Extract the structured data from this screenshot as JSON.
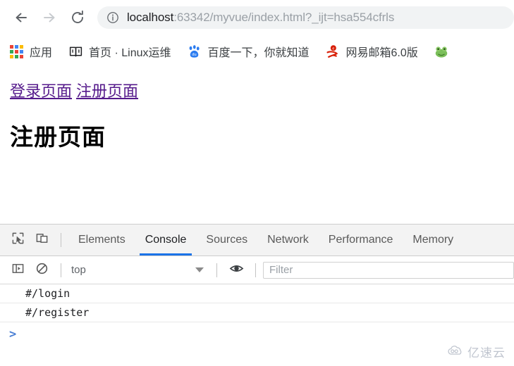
{
  "browser": {
    "nav": {
      "back_label": "Back",
      "forward_label": "Forward",
      "reload_label": "Reload"
    },
    "omnibox": {
      "info_icon": "info-circle-icon",
      "host": "localhost",
      "path": ":63342/myvue/index.html?_ijt=hsa554cfrls",
      "full_url": "localhost:63342/myvue/index.html?_ijt=hsa554cfrls"
    },
    "bookmarks": [
      {
        "label": "应用",
        "icon": "apps-grid-icon"
      },
      {
        "label": "首页 · Linux运维",
        "icon": "open-book-icon"
      },
      {
        "label": "百度一下，你就知道",
        "icon": "baidu-paw-icon"
      },
      {
        "label": "网易邮箱6.0版",
        "icon": "netease-mail-icon"
      },
      {
        "label": "",
        "icon": "frog-icon"
      }
    ]
  },
  "page": {
    "links": [
      {
        "label": "登录页面",
        "href": "#/login"
      },
      {
        "label": "注册页面",
        "href": "#/register"
      }
    ],
    "title": "注册页面"
  },
  "devtools": {
    "tools": [
      {
        "name": "inspect-element-icon"
      },
      {
        "name": "device-toolbar-icon"
      }
    ],
    "tabs": [
      {
        "label": "Elements",
        "active": false
      },
      {
        "label": "Console",
        "active": true
      },
      {
        "label": "Sources",
        "active": false
      },
      {
        "label": "Network",
        "active": false
      },
      {
        "label": "Performance",
        "active": false
      },
      {
        "label": "Memory",
        "active": false
      }
    ],
    "console_toolbar": {
      "sidebar_icon": "console-sidebar-icon",
      "clear_icon": "clear-console-icon",
      "context_value": "top",
      "eye_icon": "live-expression-eye-icon",
      "filter_placeholder": "Filter",
      "filter_value": ""
    },
    "console_messages": [
      "#/login",
      "#/register"
    ],
    "prompt_symbol": ">"
  },
  "watermark": {
    "text": "亿速云",
    "icon": "cloud-icon"
  },
  "colors": {
    "accent_blue": "#1a73e8",
    "visited_link": "#551a8b",
    "omnibox_bg": "#f1f3f4",
    "devtools_bg": "#f3f3f3"
  }
}
